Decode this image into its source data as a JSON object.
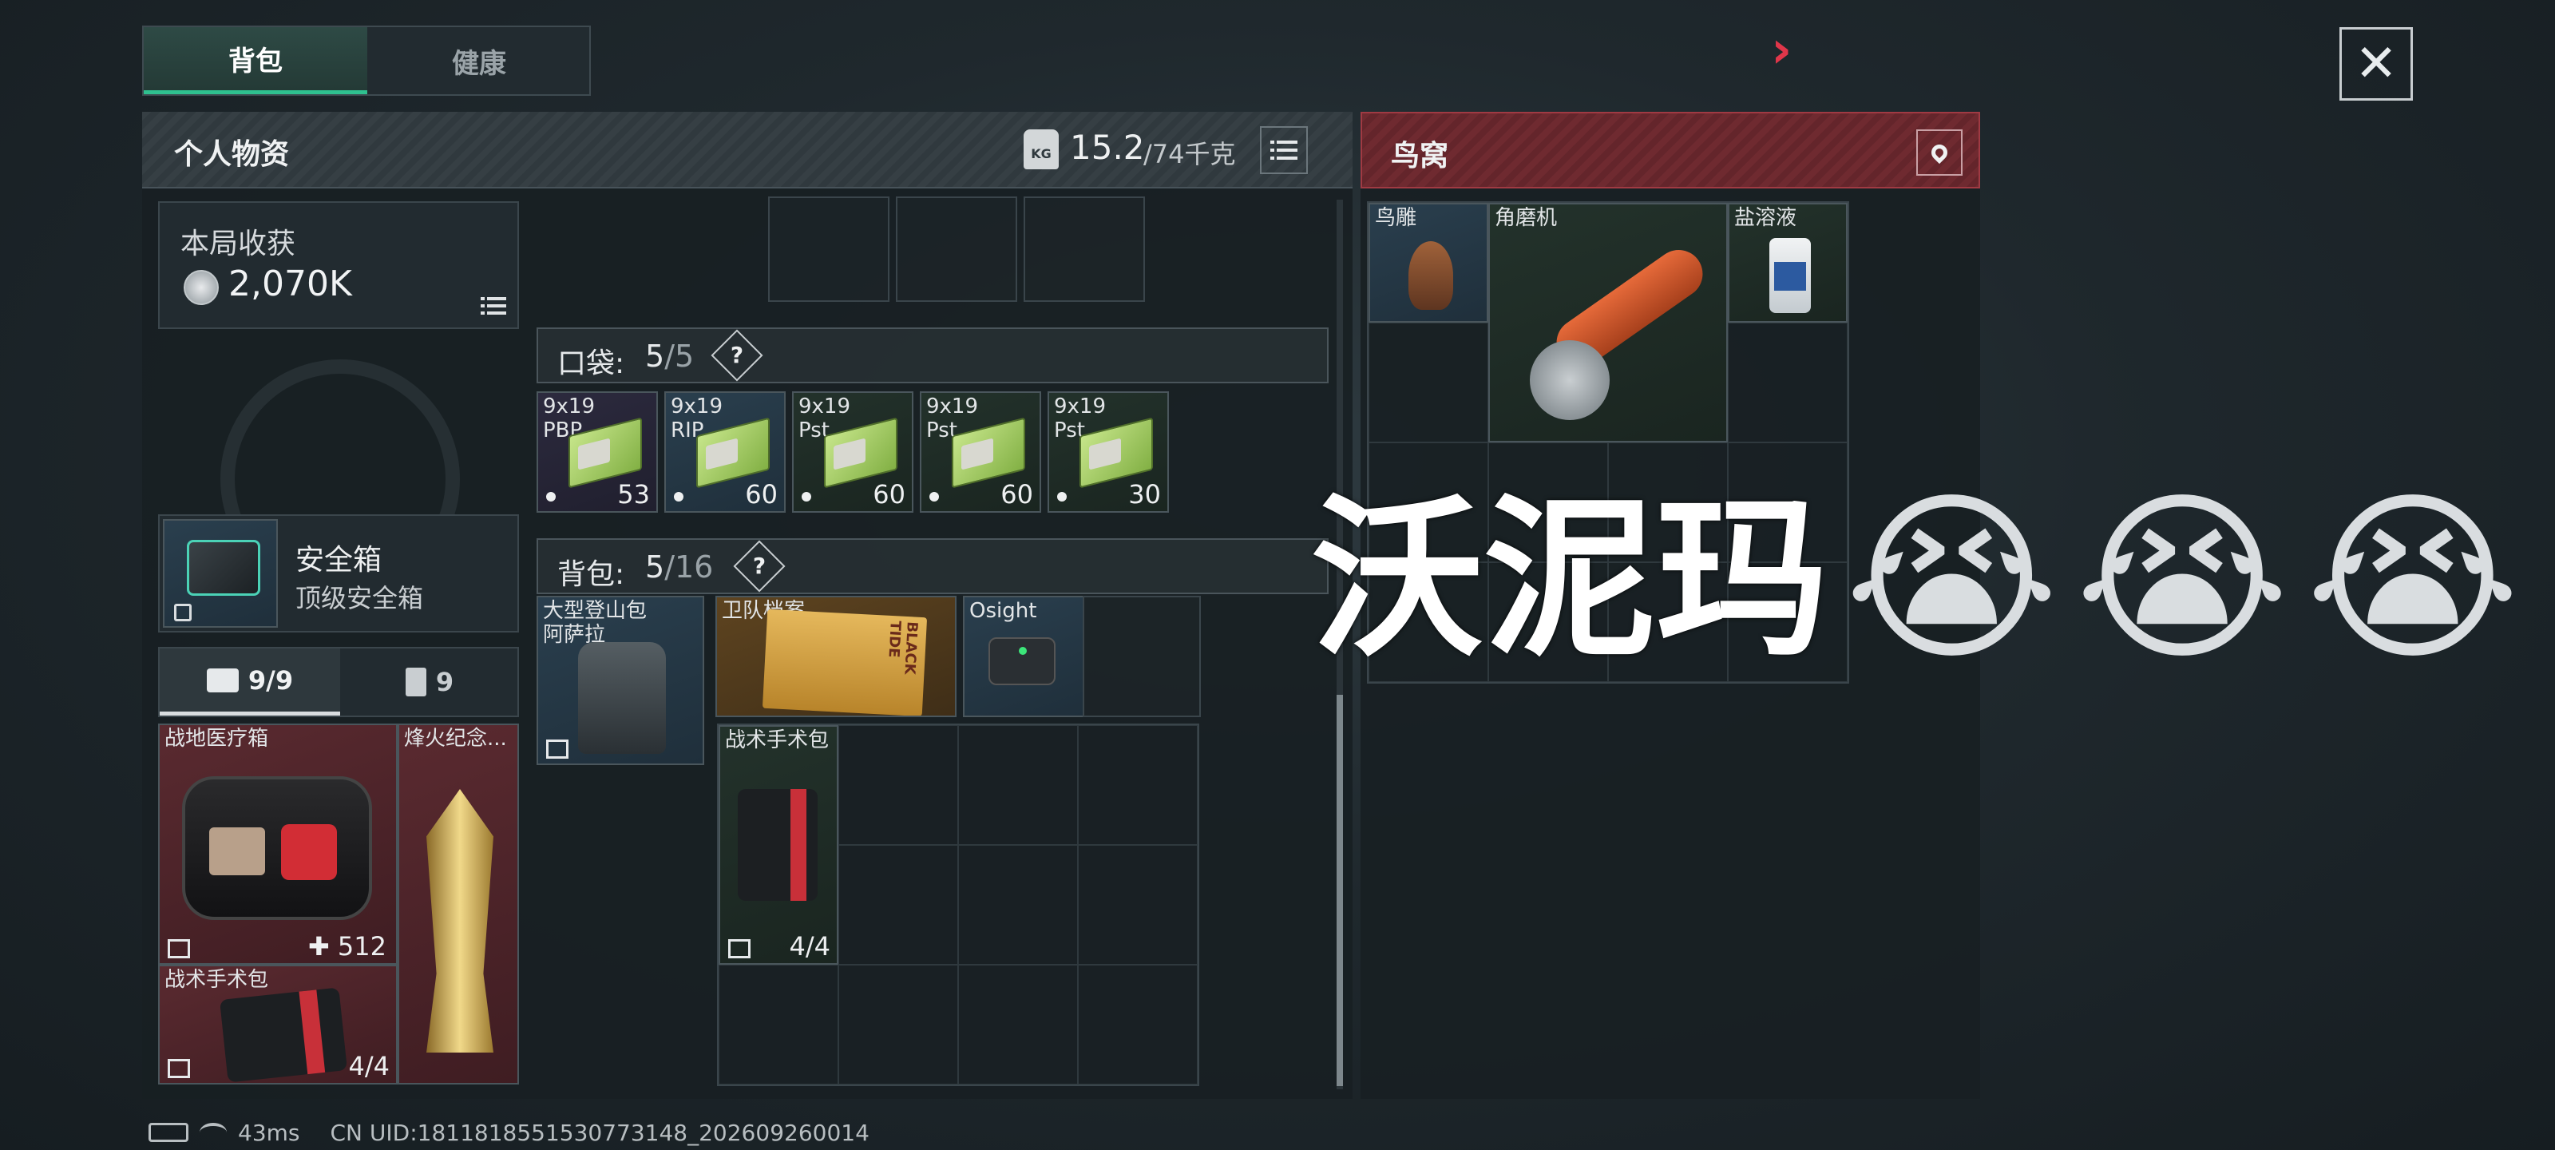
{
  "tabs": [
    {
      "label": "背包"
    },
    {
      "label": "健康"
    }
  ],
  "personal": {
    "title": "个人物资",
    "weight": "15.2",
    "weight_max": "/74千克",
    "kg_label": "KG"
  },
  "haul": {
    "label": "本局收获",
    "value": "2,070K"
  },
  "safe": {
    "title": "安全箱",
    "subtitle": "顶级安全箱"
  },
  "subtabs": [
    {
      "label": "9/9"
    },
    {
      "label": "9"
    }
  ],
  "side_items": {
    "medkit_name": "战地医疗箱",
    "medkit_qty": "512",
    "trophy_name": "烽火纪念...",
    "surgery_name": "战术手术包",
    "surgery_qty": "4/4"
  },
  "pocket": {
    "label": "口袋:",
    "count": "5",
    "total": "/5",
    "help": "?"
  },
  "pocket_items": [
    {
      "name": "9x19\nPBP",
      "qty": "53"
    },
    {
      "name": "9x19\nRIP",
      "qty": "60"
    },
    {
      "name": "9x19\nPst",
      "qty": "60"
    },
    {
      "name": "9x19\nPst",
      "qty": "60"
    },
    {
      "name": "9x19\nPst",
      "qty": "30"
    }
  ],
  "backpack": {
    "label": "背包:",
    "count": "5",
    "total": "/16",
    "help": "?"
  },
  "backpack_items": {
    "bag_name": "大型登山包\n阿萨拉",
    "file_name": "卫队档案",
    "file_text": "BLACK TIDE",
    "osight_name": "Osight",
    "kit_name": "战术手术包",
    "kit_qty": "4/4"
  },
  "loot": {
    "title": "鸟窝",
    "items": [
      {
        "name": "鸟雕"
      },
      {
        "name": "角磨机"
      },
      {
        "name": "盐溶液"
      }
    ]
  },
  "overlay_text": "沃泥玛",
  "emojis": [
    "😭",
    "😭",
    "😭"
  ],
  "status": {
    "ping": "43ms",
    "uid": "CN UID:1811818551530773148_202609260014"
  },
  "close": "✕",
  "arrow": "›",
  "colors": {
    "accent_green": "#2fc08f",
    "loot_red": "#8c2f36"
  }
}
